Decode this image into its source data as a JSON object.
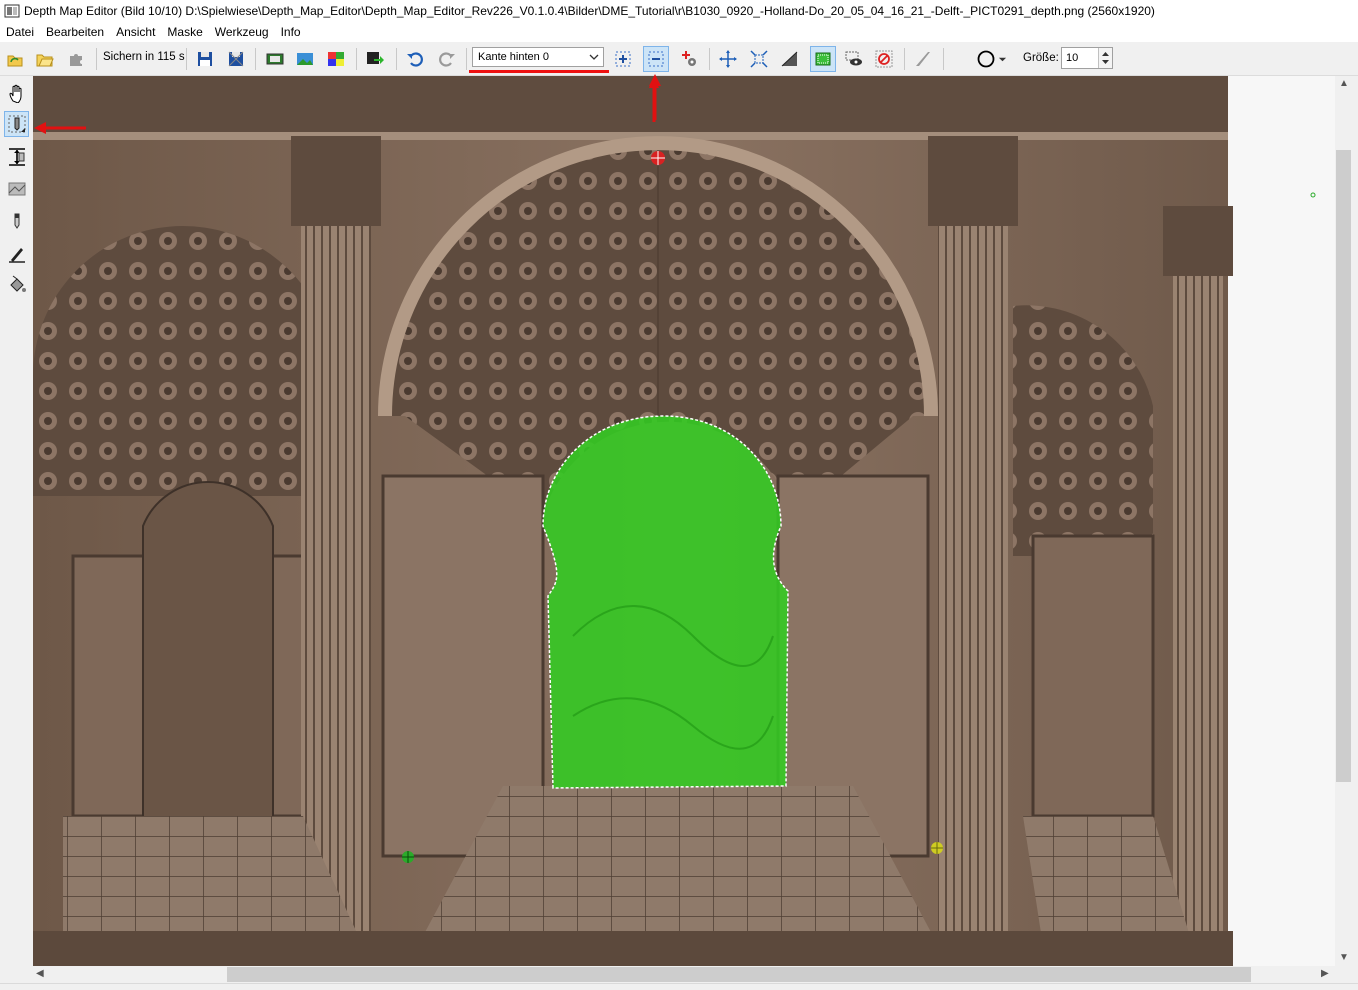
{
  "window": {
    "title": "Depth Map Editor (Bild 10/10) D:\\Spielwiese\\Depth_Map_Editor\\Depth_Map_Editor_Rev226_V0.1.0.4\\Bilder\\DME_Tutorial\\r\\B1030_0920_-Holland-Do_20_05_04_16_21_-Delft-_PICT0291_depth.png (2560x1920)"
  },
  "menu": [
    "Datei",
    "Bearbeiten",
    "Ansicht",
    "Maske",
    "Werkzeug",
    "Info"
  ],
  "toolbar": {
    "save_timer": "Sichern in 115 s",
    "edge_select": {
      "value": "Kante hinten 0"
    },
    "size_label": "Größe:",
    "size_value": "10"
  },
  "colors": {
    "mask": "#33cc22",
    "annotation": "#e11111",
    "selection_bg": "#cce4f7"
  }
}
